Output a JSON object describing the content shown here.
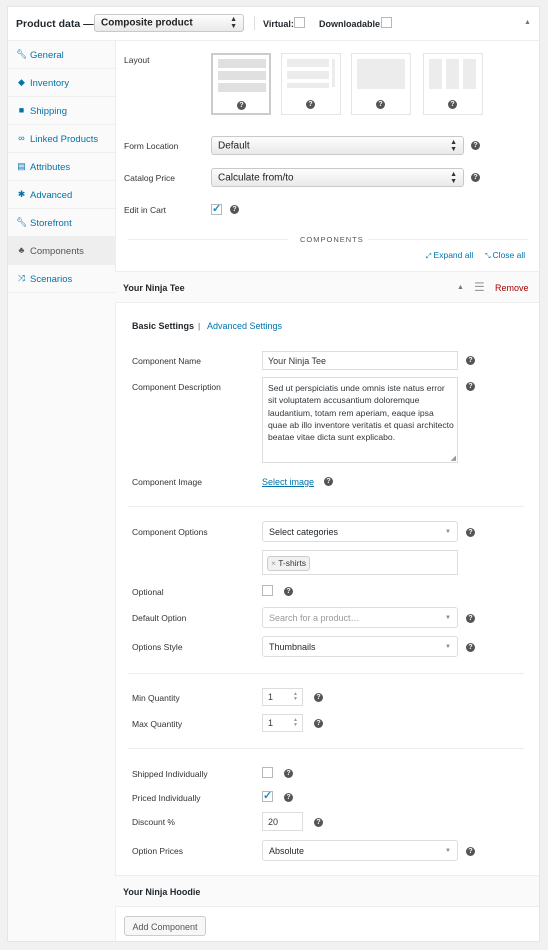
{
  "header": {
    "title": "Product data —",
    "product_type": "Composite product",
    "virtual_label": "Virtual:",
    "downloadable_label": "Downloadable:"
  },
  "sidebar": {
    "items": [
      {
        "label": "General",
        "icon": "wrench-icon"
      },
      {
        "label": "Inventory",
        "icon": "tag-icon"
      },
      {
        "label": "Shipping",
        "icon": "truck-icon"
      },
      {
        "label": "Linked Products",
        "icon": "link-icon"
      },
      {
        "label": "Attributes",
        "icon": "list-icon"
      },
      {
        "label": "Advanced",
        "icon": "gear-icon"
      },
      {
        "label": "Storefront",
        "icon": "wrench-icon"
      },
      {
        "label": "Components",
        "icon": "components-icon"
      },
      {
        "label": "Scenarios",
        "icon": "shuffle-icon"
      }
    ]
  },
  "settings": {
    "layout_label": "Layout",
    "form_location_label": "Form Location",
    "form_location_value": "Default",
    "catalog_price_label": "Catalog Price",
    "catalog_price_value": "Calculate from/to",
    "edit_in_cart_label": "Edit in Cart",
    "help": "?"
  },
  "components": {
    "heading": "COMPONENTS",
    "expand_all": "Expand all",
    "close_all": "Close all",
    "first": {
      "title": "Your Ninja Tee",
      "remove": "Remove",
      "tab_basic": "Basic Settings",
      "tab_sep": "|",
      "tab_advanced": "Advanced Settings",
      "name_label": "Component Name",
      "name_value": "Your Ninja Tee",
      "desc_label": "Component Description",
      "desc_value": "Sed ut perspiciatis unde omnis iste natus error sit voluptatem accusantium doloremque laudantium, totam rem aperiam, eaque ipsa quae ab illo inventore veritatis et quasi architecto beatae vitae dicta sunt explicabo.",
      "image_label": "Component Image",
      "image_link": "Select image",
      "options_label": "Component Options",
      "options_value": "Select categories",
      "tag": "T-shirts",
      "tag_remove": "×",
      "optional_label": "Optional",
      "default_label": "Default Option",
      "default_placeholder": "Search for a product…",
      "style_label": "Options Style",
      "style_value": "Thumbnails",
      "min_label": "Min Quantity",
      "min_value": "1",
      "max_label": "Max Quantity",
      "max_value": "1",
      "shipped_label": "Shipped Individually",
      "priced_label": "Priced Individually",
      "discount_label": "Discount %",
      "discount_value": "20",
      "prices_label": "Option Prices",
      "prices_value": "Absolute"
    },
    "second": {
      "title": "Your Ninja Hoodie"
    },
    "add_button": "Add Component"
  },
  "colors": {
    "link": "#0073aa",
    "remove": "#a00",
    "accent": "#1e8cbe"
  }
}
